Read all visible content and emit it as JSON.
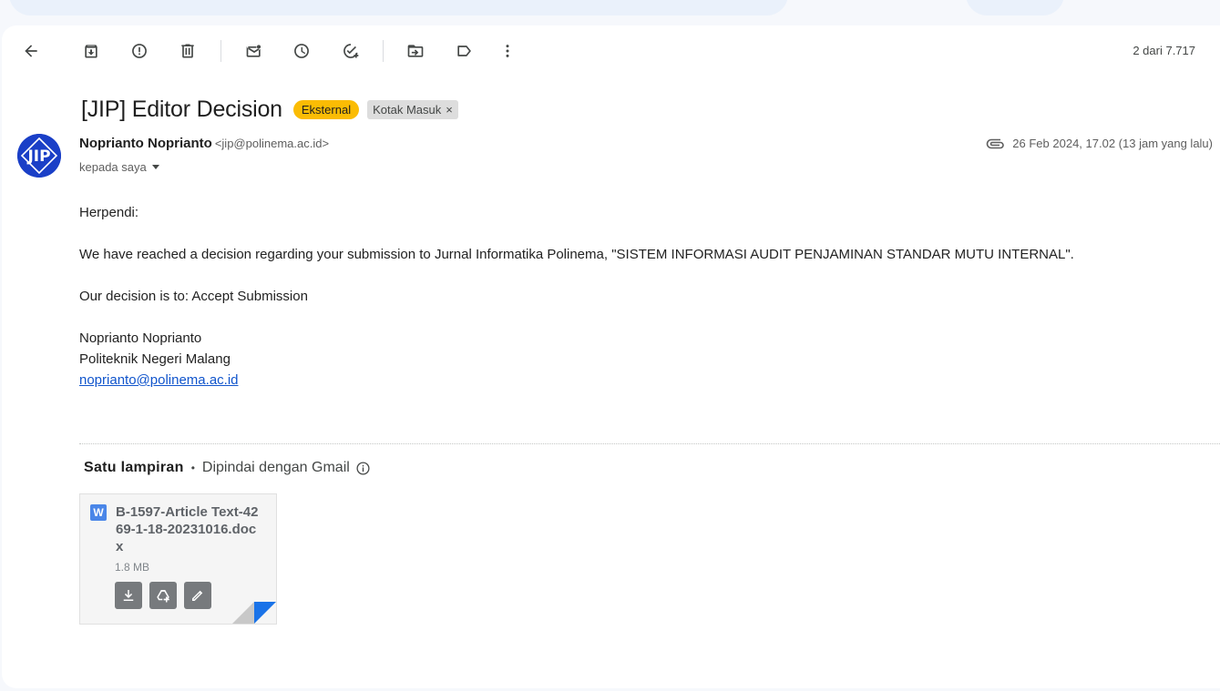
{
  "toolbar": {
    "page_count": "2 dari 7.717"
  },
  "message": {
    "subject": "[JIP] Editor Decision",
    "labels": {
      "external": "Eksternal",
      "inbox": "Kotak Masuk",
      "inbox_remove": "×"
    },
    "sender": {
      "name": "Noprianto Noprianto",
      "email": "<jip@polinema.ac.id>",
      "avatar_text": "JIP"
    },
    "recipient": "kepada saya",
    "date": "26 Feb 2024, 17.02 (13 jam yang lalu)",
    "body": {
      "greeting": "Herpendi:",
      "paragraph1": "We have reached a decision regarding your submission to Jurnal Informatika Polinema, \"SISTEM INFORMASI AUDIT PENJAMINAN STANDAR MUTU INTERNAL\".",
      "paragraph2": "Our decision is to: Accept Submission",
      "signature_name": "Noprianto Noprianto",
      "signature_org": "Politeknik Negeri Malang",
      "signature_email": "noprianto@polinema.ac.id"
    }
  },
  "attachments": {
    "header_count": "Satu lampiran",
    "header_separator": "•",
    "header_scanned": "Dipindai dengan Gmail",
    "items": [
      {
        "type_letter": "W",
        "name": "B-1597-Article Text-4269-1-18-20231016.docx",
        "size": "1.8 MB"
      }
    ]
  },
  "colors": {
    "external_badge": "#fbbc04",
    "link": "#1155cc",
    "avatar_bg": "#1a3fc7",
    "word_icon": "#4a86e8"
  }
}
